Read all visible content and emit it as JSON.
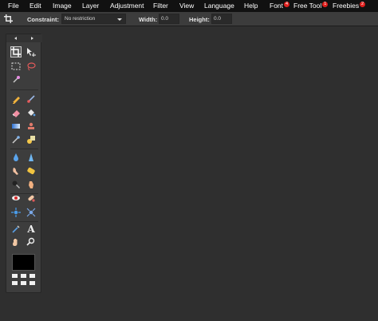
{
  "menu": {
    "items": [
      {
        "label": "File"
      },
      {
        "label": "Edit"
      },
      {
        "label": "Image"
      },
      {
        "label": "Layer"
      },
      {
        "label": "Adjustment"
      },
      {
        "label": "Filter"
      },
      {
        "label": "View"
      },
      {
        "label": "Language"
      },
      {
        "label": "Help"
      },
      {
        "label": "Font",
        "badge": "4"
      },
      {
        "label": "Free Tool",
        "badge": "1"
      },
      {
        "label": "Freebies",
        "badge": "2"
      }
    ]
  },
  "options": {
    "constraint_label": "Constraint:",
    "constraint_value": "No restriction",
    "width_label": "Width:",
    "width_value": "0.0",
    "height_label": "Height:",
    "height_value": "0.0"
  },
  "tools": {
    "items": [
      {
        "id": "crop",
        "icon": "crop-icon",
        "active": true
      },
      {
        "id": "move",
        "icon": "move-icon"
      },
      {
        "id": "marquee",
        "icon": "marquee-icon"
      },
      {
        "id": "lasso",
        "icon": "lasso-icon"
      },
      {
        "id": "magic-wand",
        "icon": "magic-wand-icon"
      },
      {
        "id": "pencil",
        "icon": "pencil-icon"
      },
      {
        "id": "brush",
        "icon": "brush-icon"
      },
      {
        "id": "eraser",
        "icon": "eraser-icon"
      },
      {
        "id": "paint-bucket",
        "icon": "paint-bucket-icon"
      },
      {
        "id": "gradient",
        "icon": "gradient-icon"
      },
      {
        "id": "clone-stamp",
        "icon": "clone-stamp-icon"
      },
      {
        "id": "color-replace",
        "icon": "color-replace-icon"
      },
      {
        "id": "shape",
        "icon": "shape-icon"
      },
      {
        "id": "drop",
        "icon": "drop-icon"
      },
      {
        "id": "sharpen",
        "icon": "sharpen-icon"
      },
      {
        "id": "smudge",
        "icon": "smudge-icon"
      },
      {
        "id": "sponge",
        "icon": "sponge-icon"
      },
      {
        "id": "burn",
        "icon": "burn-icon"
      },
      {
        "id": "dodge",
        "icon": "dodge-icon"
      },
      {
        "id": "red-eye",
        "icon": "red-eye-icon"
      },
      {
        "id": "spot-heal",
        "icon": "spot-heal-icon"
      },
      {
        "id": "bloat",
        "icon": "bloat-icon"
      },
      {
        "id": "pinch",
        "icon": "pinch-icon"
      },
      {
        "id": "color-picker",
        "icon": "color-picker-icon"
      },
      {
        "id": "text",
        "icon": "text-icon",
        "glyph": "A"
      },
      {
        "id": "hand",
        "icon": "hand-icon"
      },
      {
        "id": "zoom",
        "icon": "zoom-icon"
      }
    ]
  },
  "colors": {
    "menubar": "#111111",
    "toolbar": "#3c3c3c",
    "canvas": "#2f2f2f",
    "panel": "#3d3d3d",
    "badge": "#e0201e",
    "primary_color": "#000000"
  }
}
